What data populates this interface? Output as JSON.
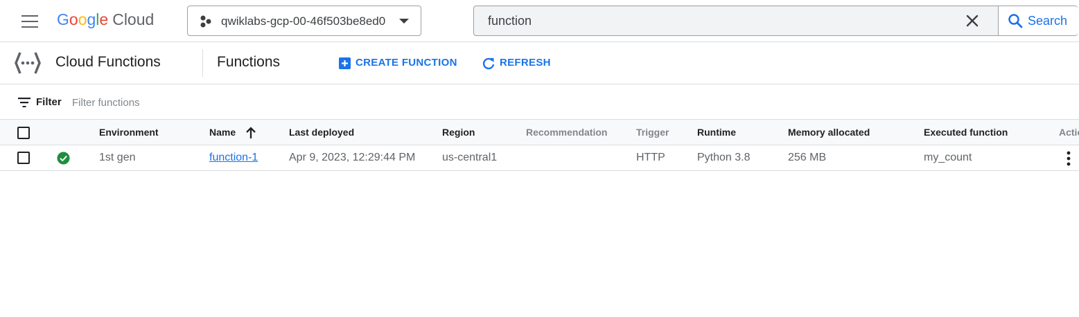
{
  "topbar": {
    "logo_google": [
      "G",
      "o",
      "o",
      "g",
      "l",
      "e"
    ],
    "logo_colors": [
      "#4285F4",
      "#EA4335",
      "#FBBC05",
      "#4285F4",
      "#34A853",
      "#EA4335"
    ],
    "logo_product": "Cloud",
    "project_name": "qwiklabs-gcp-00-46f503be8ed0",
    "search_value": "function",
    "search_button": "Search"
  },
  "header": {
    "product_title": "Cloud Functions",
    "page_title": "Functions",
    "create_label": "CREATE FUNCTION",
    "refresh_label": "REFRESH"
  },
  "filter": {
    "label": "Filter",
    "placeholder": "Filter functions"
  },
  "table": {
    "columns": {
      "environment": "Environment",
      "name": "Name",
      "last_deployed": "Last deployed",
      "region": "Region",
      "recommendation": "Recommendation",
      "trigger": "Trigger",
      "runtime": "Runtime",
      "memory": "Memory allocated",
      "executed": "Executed function",
      "actions": "Actions"
    },
    "sort": {
      "column": "Name",
      "direction": "ascending"
    },
    "rows": [
      {
        "status": "ok",
        "environment": "1st gen",
        "name": "function-1",
        "last_deployed": "Apr 9, 2023, 12:29:44 PM",
        "region": "us-central1",
        "recommendation": "",
        "trigger": "HTTP",
        "runtime": "Python 3.8",
        "memory": "256 MB",
        "executed": "my_count"
      }
    ]
  },
  "colors": {
    "accent": "#1a73e8",
    "status_ok": "#1e8e3e"
  },
  "icons": [
    "menu-icon",
    "project-icon",
    "chevron-down-icon",
    "close-icon",
    "search-icon",
    "cloud-functions-icon",
    "add-box-icon",
    "refresh-icon",
    "filter-icon",
    "arrow-up-icon",
    "check-circle-icon",
    "more-vert-icon"
  ]
}
